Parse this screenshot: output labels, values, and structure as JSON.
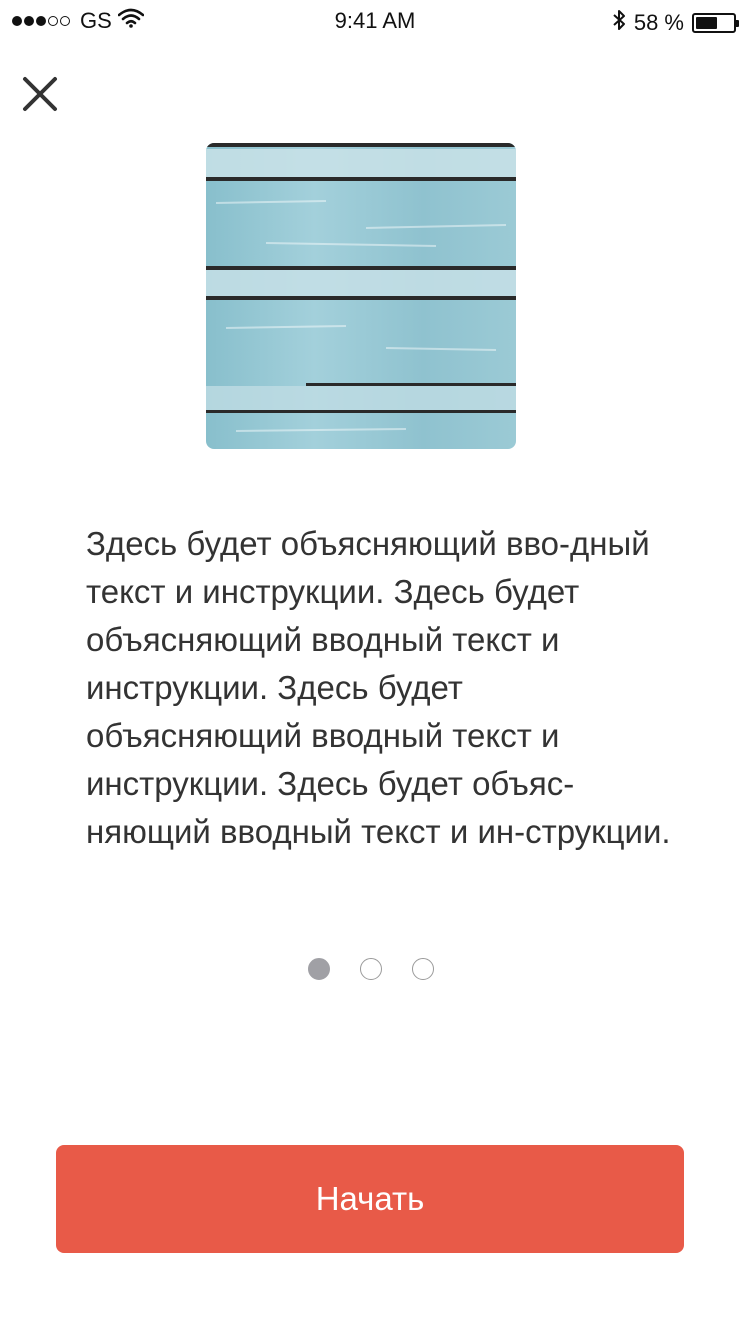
{
  "status_bar": {
    "carrier": "GS",
    "time": "9:41 AM",
    "battery_text": "58 %",
    "battery_level": 0.58,
    "signal_bars_filled": 3,
    "signal_bars_total": 5,
    "icons": [
      "signal-dots-icon",
      "wifi-icon",
      "bluetooth-icon",
      "battery-icon"
    ]
  },
  "header": {
    "close_icon": "close-icon"
  },
  "hero": {
    "description": "image-placeholder"
  },
  "content": {
    "intro_text": "Здесь будет объясняющий вво-дный текст и инструкции. Здесь будет объясняющий вводный текст и инструкции. Здесь будет объясняющий вводный текст и инструкции. Здесь будет объяс-няющий вводный текст и ин-струкции."
  },
  "pager": {
    "total": 3,
    "active_index": 0
  },
  "actions": {
    "start_label": "Начать"
  },
  "colors": {
    "accent": "#e85a48",
    "text": "#333333",
    "pager_active": "#a0a0a5",
    "pager_inactive_border": "#9a9a9a",
    "hero_tint": "#8fc2cf"
  }
}
